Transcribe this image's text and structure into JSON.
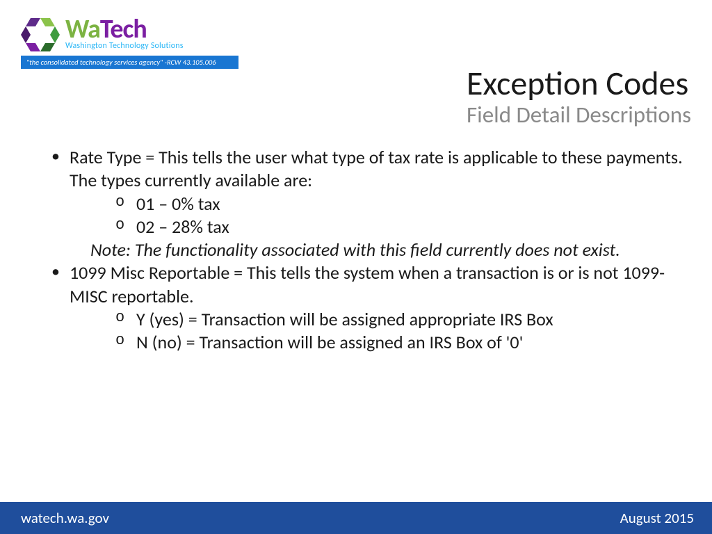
{
  "logo": {
    "brand_wa": "Wa",
    "brand_tech": "Tech",
    "tagline": "Washington Technology Solutions",
    "banner": "\"the consolidated technology services agency\" -RCW 43.105.006"
  },
  "title": {
    "main": "Exception Codes",
    "sub": "Field Detail Descriptions"
  },
  "bullets": {
    "rate_type": "Rate Type = This tells the user what type of tax rate is applicable to these payments.  The types currently available are:",
    "rate_sub_01": "01 – 0% tax",
    "rate_sub_02": "02 – 28% tax",
    "note": "Note:  The functionality associated with this field currently does not exist.",
    "misc": "1099 Misc Reportable = This tells the system when a transaction is or is not 1099-MISC reportable.",
    "misc_y": "Y (yes) =  Transaction will be assigned appropriate IRS Box",
    "misc_n": "N (no) = Transaction will be assigned an IRS Box of '0'"
  },
  "footer": {
    "left": "watech.wa.gov",
    "right": "August 2015"
  }
}
